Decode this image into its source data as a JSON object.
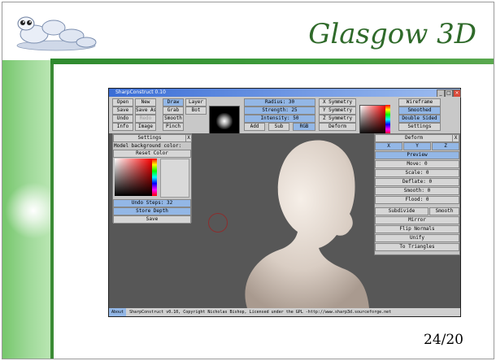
{
  "slide": {
    "title": "Glasgow 3D",
    "page_number": "24/20"
  },
  "app": {
    "window_title": "SharpConstruct 0.10",
    "toolbar": {
      "file": [
        "Open",
        "New",
        "Save",
        "Save As",
        "Undo",
        "Redo",
        "Info",
        "Image"
      ],
      "tools": [
        "Draw",
        "Layer",
        "Grab",
        "Bot",
        "Smooth",
        "Pinch"
      ],
      "params": {
        "radius": "Radius: 30",
        "strength": "Strength: 25",
        "intensity": "Intensity: 50"
      },
      "mode": [
        "Add",
        "Sub",
        "RGB"
      ],
      "symmetry": [
        "X Symmetry",
        "Y Symmetry",
        "Z Symmetry",
        "Deform"
      ],
      "display": [
        "Wireframe",
        "Smoothed",
        "Double Sided",
        "Settings"
      ]
    },
    "settings_panel": {
      "title": "Settings",
      "close": "X",
      "model_bg_label": "Model background color:",
      "reset_color": "Reset Color",
      "undo_steps": "Undo Steps: 32",
      "store_depth": "Store Depth",
      "save": "Save"
    },
    "deform_panel": {
      "title": "Deform",
      "close": "X",
      "axes": [
        "X",
        "Y",
        "Z"
      ],
      "preview": "Preview",
      "move": "Move: 0",
      "scale": "Scale: 0",
      "deflate": "Deflate: 0",
      "smooth_val": "Smooth: 0",
      "flood": "Flood: 0",
      "subdivide": "Subdivide",
      "smooth": "Smooth",
      "mirror": "Mirror",
      "flip_normals": "Flip Normals",
      "unify": "Unify",
      "to_triangles": "To Triangles"
    },
    "status": {
      "about": "About",
      "text": "SharpConstruct v0.10, Copyright Nicholas Bishop, Licensed under the GPL -http://www.sharp3d.sourceforge.net"
    }
  },
  "colors": {
    "accent_green": "#3f9e3c",
    "title_green": "#2f6a2a",
    "ui_blue": "#93b7e6"
  }
}
